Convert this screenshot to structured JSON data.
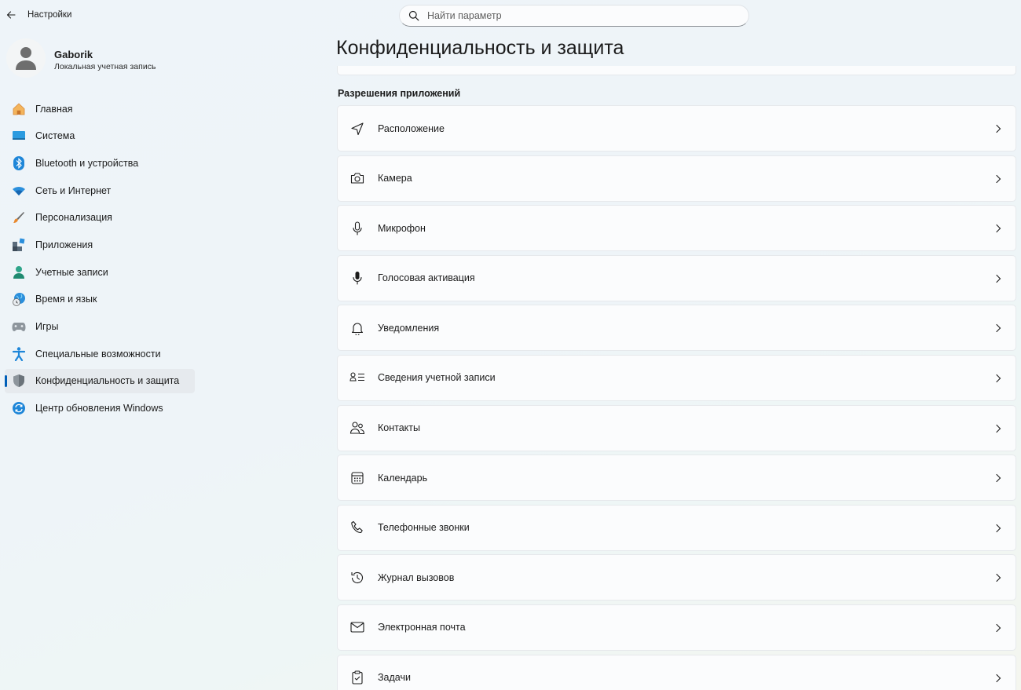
{
  "app": {
    "title": "Настройки"
  },
  "search": {
    "placeholder": "Найти параметр"
  },
  "user": {
    "name": "Gaborik",
    "account_type": "Локальная учетная запись"
  },
  "nav": {
    "items": [
      {
        "label": "Главная",
        "icon": "home-icon"
      },
      {
        "label": "Система",
        "icon": "system-icon"
      },
      {
        "label": "Bluetooth и устройства",
        "icon": "bluetooth-icon"
      },
      {
        "label": "Сеть и Интернет",
        "icon": "wifi-icon"
      },
      {
        "label": "Персонализация",
        "icon": "brush-icon"
      },
      {
        "label": "Приложения",
        "icon": "apps-icon"
      },
      {
        "label": "Учетные записи",
        "icon": "accounts-icon"
      },
      {
        "label": "Время и язык",
        "icon": "time-language-icon"
      },
      {
        "label": "Игры",
        "icon": "gamepad-icon"
      },
      {
        "label": "Специальные возможности",
        "icon": "accessibility-icon"
      },
      {
        "label": "Конфиденциальность и защита",
        "icon": "shield-icon",
        "active": true
      },
      {
        "label": "Центр обновления Windows",
        "icon": "update-icon"
      }
    ]
  },
  "main": {
    "title": "Конфиденциальность и защита",
    "section_title": "Разрешения приложений",
    "rows": [
      {
        "label": "Расположение",
        "icon": "location-icon"
      },
      {
        "label": "Камера",
        "icon": "camera-icon"
      },
      {
        "label": "Микрофон",
        "icon": "microphone-icon"
      },
      {
        "label": "Голосовая активация",
        "icon": "voice-activation-icon"
      },
      {
        "label": "Уведомления",
        "icon": "bell-icon"
      },
      {
        "label": "Сведения учетной записи",
        "icon": "account-info-icon"
      },
      {
        "label": "Контакты",
        "icon": "contacts-icon"
      },
      {
        "label": "Календарь",
        "icon": "calendar-icon"
      },
      {
        "label": "Телефонные звонки",
        "icon": "phone-icon"
      },
      {
        "label": "Журнал вызовов",
        "icon": "call-history-icon"
      },
      {
        "label": "Электронная почта",
        "icon": "mail-icon"
      },
      {
        "label": "Задачи",
        "icon": "tasks-icon"
      }
    ]
  },
  "colors": {
    "accent": "#005fb8",
    "background": "#eef4f9",
    "card": "#fbfcfd"
  }
}
